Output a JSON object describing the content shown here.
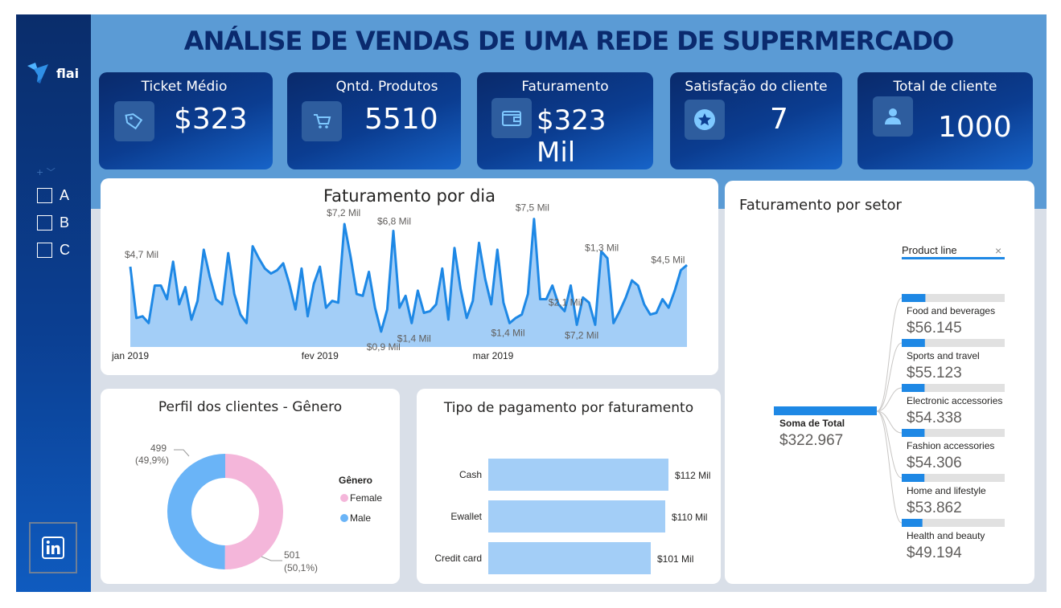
{
  "colors": {
    "navy": "#0a2a6e",
    "accent": "#1e88e5",
    "area": "#a3cef7",
    "female": "#f4b6da",
    "male": "#6ab4f7"
  },
  "brand": {
    "logo_text": "flai"
  },
  "sidebar": {
    "slicer_items": [
      {
        "label": "A"
      },
      {
        "label": "B"
      },
      {
        "label": "C"
      }
    ],
    "linkedin_icon": "linkedin-icon"
  },
  "title": "ANÁLISE DE VENDAS DE UMA REDE DE SUPERMERCADO",
  "kpis": [
    {
      "label": "Ticket Médio",
      "value": "$323",
      "icon": "tag-icon"
    },
    {
      "label": "Qntd. Produtos",
      "value": "5510",
      "icon": "cart-icon"
    },
    {
      "label": "Faturamento",
      "value": "$323 Mil",
      "icon": "wallet-icon"
    },
    {
      "label": "Satisfação do cliente",
      "value": "7",
      "icon": "star-icon"
    },
    {
      "label": "Total de cliente",
      "value": "1000",
      "icon": "person-icon"
    }
  ],
  "daily": {
    "title": "Faturamento por dia",
    "axis_labels": [
      "jan 2019",
      "fev 2019",
      "mar 2019"
    ],
    "annotations": [
      "$4,7 Mil",
      "$7,2 Mil",
      "$6,8 Mil",
      "$0,9 Mil",
      "$1,4 Mil",
      "$1,4 Mil",
      "$7,5 Mil",
      "$2,1 Mil",
      "$7,2 Mil",
      "$1,3 Mil",
      "$4,5 Mil"
    ]
  },
  "gender": {
    "title": "Perfil dos clientes - Gênero",
    "legend_title": "Gênero",
    "male_value": "499",
    "male_pct": "(49,9%)",
    "female_value": "501",
    "female_pct": "(50,1%)"
  },
  "payment": {
    "title": "Tipo de pagamento por faturamento"
  },
  "sector": {
    "title": "Faturamento por setor",
    "filter_label": "Product line",
    "filter_clear": "×",
    "root_label": "Soma de Total",
    "root_value": "$322.967"
  },
  "chart_data": [
    {
      "type": "area",
      "title": "Faturamento por dia",
      "x_start": "2019-01-01",
      "x_end": "2019-03-30",
      "x_ticks": [
        "jan 2019",
        "fev 2019",
        "mar 2019"
      ],
      "ylabel": "",
      "unit": "Mil",
      "y": [
        4.7,
        1.7,
        1.8,
        1.4,
        3.6,
        3.6,
        2.8,
        5.0,
        2.5,
        3.5,
        1.6,
        2.7,
        5.7,
        4.1,
        2.8,
        2.5,
        5.5,
        3.1,
        1.9,
        1.4,
        5.9,
        5.2,
        4.6,
        4.3,
        4.5,
        4.9,
        3.7,
        2.2,
        4.6,
        1.8,
        3.7,
        4.7,
        2.3,
        2.7,
        2.6,
        7.2,
        5.3,
        3.1,
        3.0,
        4.4,
        2.3,
        0.9,
        2.2,
        6.8,
        2.3,
        3.0,
        1.4,
        3.3,
        2.0,
        2.1,
        2.5,
        4.6,
        1.6,
        5.8,
        3.4,
        1.7,
        2.7,
        6.1,
        4.0,
        2.5,
        5.7,
        2.6,
        1.4,
        1.7,
        1.9,
        3.1,
        7.5,
        2.8,
        2.8,
        3.6,
        2.5,
        2.1,
        3.6,
        1.3,
        2.9,
        2.6,
        1.3,
        5.6,
        5.2,
        1.4,
        2.1,
        2.9,
        3.9,
        3.6,
        2.5,
        1.9,
        2.0,
        2.8,
        2.3,
        3.3,
        4.5,
        4.8
      ]
    },
    {
      "type": "pie",
      "title": "Perfil dos clientes - Gênero",
      "legend": [
        "Female",
        "Male"
      ],
      "slices": [
        {
          "name": "Female",
          "value": 501,
          "pct": 50.1
        },
        {
          "name": "Male",
          "value": 499,
          "pct": 49.9
        }
      ]
    },
    {
      "type": "bar",
      "orientation": "horizontal",
      "title": "Tipo de pagamento por faturamento",
      "categories": [
        "Cash",
        "Ewallet",
        "Credit card"
      ],
      "values": [
        112,
        110,
        101
      ],
      "value_labels": [
        "$112 Mil",
        "$110 Mil",
        "$101 Mil"
      ]
    },
    {
      "type": "bar",
      "title": "Faturamento por setor",
      "categories": [
        "Food and beverages",
        "Sports and travel",
        "Electronic accessories",
        "Fashion accessories",
        "Home and lifestyle",
        "Health and beauty"
      ],
      "values": [
        56145,
        55123,
        54338,
        54306,
        53862,
        49194
      ],
      "value_labels": [
        "$56.145",
        "$55.123",
        "$54.338",
        "$54.306",
        "$53.862",
        "$49.194"
      ],
      "total": 322967
    }
  ]
}
